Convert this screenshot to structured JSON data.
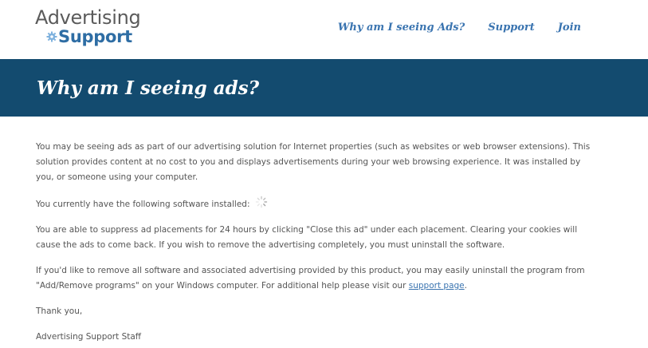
{
  "logo": {
    "line1": "Advertising",
    "line2": "Support",
    "gear_icon": "gear-icon"
  },
  "nav": {
    "items": [
      {
        "label": "Why am I seeing Ads?"
      },
      {
        "label": "Support"
      },
      {
        "label": "Join"
      }
    ]
  },
  "banner": {
    "title": "Why am I seeing ads?"
  },
  "content": {
    "p1": "You may be seeing ads as part of our advertising solution for Internet properties (such as websites or web browser extensions). This solution provides content at no cost to you and displays advertisements during your web browsing experience. It was installed by you, or someone using your computer.",
    "p2": "You currently have the following software installed:",
    "loading_icon": "loading-spinner-icon",
    "p3": "You are able to suppress ad placements for 24 hours by clicking \"Close this ad\" under each placement. Clearing your cookies will cause the ads to come back. If you wish to remove the advertising completely, you must uninstall the software.",
    "p4_before": "If you'd like to remove all software and associated advertising provided by this product, you may easily uninstall the program from \"Add/Remove programs\" on your Windows computer. For additional help please visit our ",
    "p4_link": "support page",
    "p4_after": ".",
    "p5": "Thank you,",
    "p6": "Advertising Support Staff"
  },
  "colors": {
    "banner_bg": "#134b6f",
    "nav_link": "#3a74b0",
    "logo_accent": "#2e6da4",
    "body_text": "#555555"
  }
}
